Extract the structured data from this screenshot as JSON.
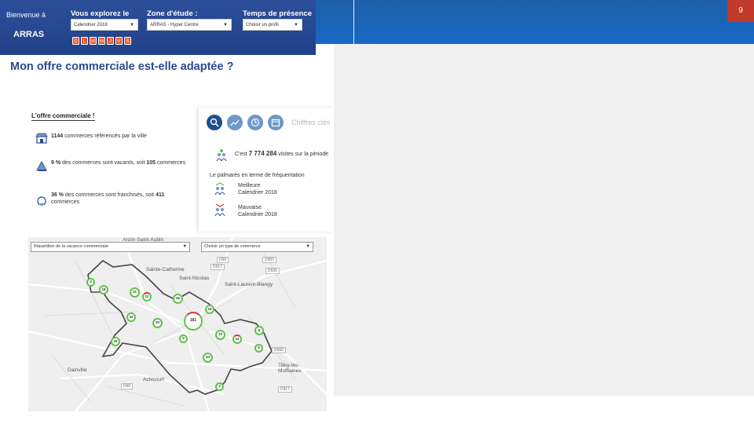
{
  "slide": {
    "page_number": "9"
  },
  "header": {
    "welcome": "Bienvenue à",
    "city": "ARRAS",
    "explore_label": "Vous explorez le",
    "explore_value": "Calendrier 2018",
    "zone_label": "Zone d'étude :",
    "zone_value": "ARRAS - Hyper Centre",
    "presence_label": "Temps de présence :",
    "presence_value": "Choisir un profil",
    "days": [
      "D",
      "L",
      "M",
      "M",
      "J",
      "V",
      "S"
    ]
  },
  "page_title": "Mon offre commerciale est-elle adaptée ?",
  "offer": {
    "title": "L'offre commerciale !",
    "stats": [
      {
        "strong": "1144",
        "text": " commerces référencés par la ville"
      },
      {
        "strong": "9 %",
        "text": " des commerces sont vacants, soit ",
        "strong2": "105",
        "text2": " commerces"
      },
      {
        "strong": "36 %",
        "text": " des commerces sont franchisés, soit ",
        "strong2": "411",
        "text2": " commerces"
      }
    ]
  },
  "figures": {
    "label": "Chiffres clés",
    "visits_prefix": "C'est ",
    "visits_value": "7 774 284",
    "visits_suffix": " visites  sur la période",
    "ranking_title": "Le palmarès en terme de fréquentation",
    "best_label": "Meilleure",
    "best_value": "Calendrier 2018",
    "worst_label": "Mauvaise",
    "worst_value": "Calendrier 2018"
  },
  "map": {
    "select_left": "Répartition de la vacance commerciale",
    "select_right": "Choisir un type de commerce",
    "places": [
      "Sainte-Catherine",
      "Saint-Nicolas",
      "Saint-Laurent-Blangy",
      "Dainville",
      "Achicourt",
      "Tilloy-lès-Mofflaines",
      "Anzin-Saint-Aubin"
    ],
    "roads": [
      "D60",
      "D917",
      "D950",
      "D939",
      "D950",
      "D60",
      "D917"
    ],
    "markers": [
      {
        "label": "4"
      },
      {
        "label": "18"
      },
      {
        "label": "31"
      },
      {
        "label": "12"
      },
      {
        "label": "46"
      },
      {
        "label": "15"
      },
      {
        "label": "32"
      },
      {
        "label": "30"
      },
      {
        "label": "181"
      },
      {
        "label": "8"
      },
      {
        "label": "20"
      },
      {
        "label": "22"
      },
      {
        "label": "14"
      },
      {
        "label": "9"
      },
      {
        "label": "6"
      },
      {
        "label": "34"
      },
      {
        "label": "2"
      }
    ]
  },
  "colors": {
    "header": "#2d4f9a",
    "banner": "#1769c5",
    "title": "#2c4a8f",
    "accent": "#e8572b",
    "marker": "#5cc447",
    "page_badge": "#c0392b"
  }
}
